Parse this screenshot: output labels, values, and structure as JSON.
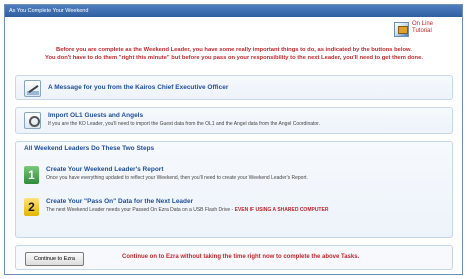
{
  "window": {
    "title": "As You Complete Your Weekend"
  },
  "tutorial": {
    "line1": "On Line",
    "line2": "Tutorial"
  },
  "intro": {
    "line1": "Before you are complete as the Weekend Leader, you have some really important things to do, as indicated by the buttons below.",
    "line2": "You don't have to do them \"right this minute\" but before you pass on your responsibility to the next Leader, you'll need to get them done."
  },
  "message": {
    "title": "A Message for you from the Kairos Chief Executive Officer"
  },
  "import": {
    "title": "Import OL1 Guests and Angels",
    "subtitle": "If you are the KO Leader, you'll need to import the Guest data from the OL1 and the Angel data from the Angel Coordinator."
  },
  "steps": {
    "header": "All Weekend Leaders Do These Two Steps",
    "step1": {
      "number": "1",
      "title": "Create Your Weekend Leader's Report",
      "subtitle": "Once you have everything updated to reflect your Weekend, then you'll need to create your Weekend Leader's Report."
    },
    "step2": {
      "number": "2",
      "title": "Create Your \"Pass On\" Data for the Next Leader",
      "subtitle": "The next Weekend Leader needs your Passed On Ezra Data on a USB Flash Drive -",
      "warning": "EVEN IF USING A SHARED COMPUTER"
    }
  },
  "footer": {
    "button_label": "Continue to Ezra",
    "note": "Continue on to Ezra without taking the time right now to complete the above Tasks."
  },
  "colors": {
    "title_red": "#c0272d",
    "title_blue": "#1f4e9a",
    "window_bar": "#2f5f9f"
  },
  "icons": [
    "tutorial-icon",
    "pen-icon",
    "gear-icon",
    "number-1-badge",
    "number-2-badge"
  ]
}
